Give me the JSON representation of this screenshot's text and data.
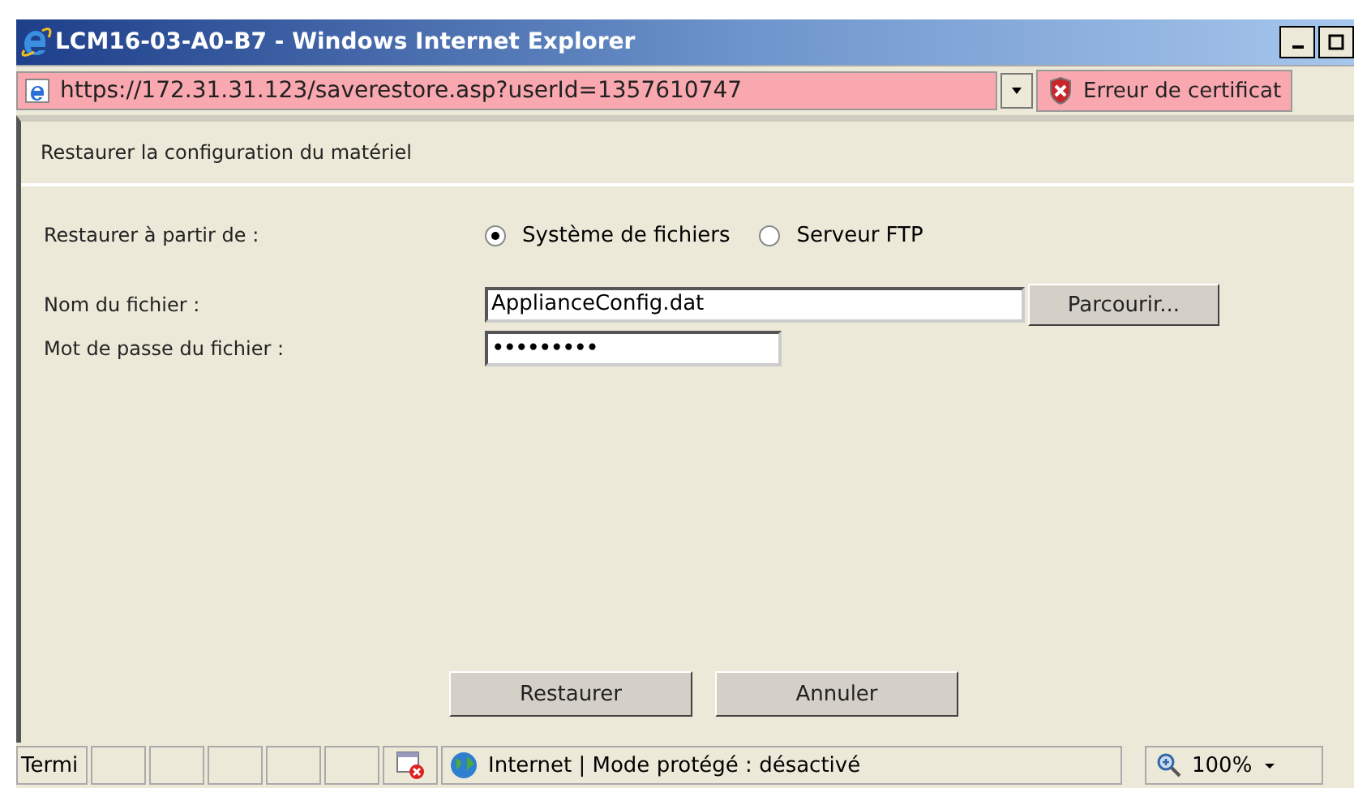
{
  "window": {
    "title": "LCM16-03-A0-B7 - Windows Internet Explorer"
  },
  "address_bar": {
    "url": "https://172.31.31.123/saverestore.asp?userId=1357610747",
    "certificate_error": "Erreur de certificat"
  },
  "dialog": {
    "heading": "Restaurer la configuration du matériel",
    "restore_from": {
      "label": "Restaurer à partir de :",
      "options": [
        {
          "label": "Système de fichiers",
          "selected": true
        },
        {
          "label": "Serveur FTP",
          "selected": false
        }
      ]
    },
    "file_name": {
      "label": "Nom du fichier :",
      "value": "ApplianceConfig.dat",
      "browse": "Parcourir..."
    },
    "file_password": {
      "label": "Mot de passe du fichier :",
      "value": "•••••••••"
    },
    "buttons": [
      "Restaurer",
      "Annuler"
    ]
  },
  "status_bar": {
    "status": "Termi",
    "zone": "Internet | Mode protégé : désactivé",
    "zoom": "100%"
  }
}
